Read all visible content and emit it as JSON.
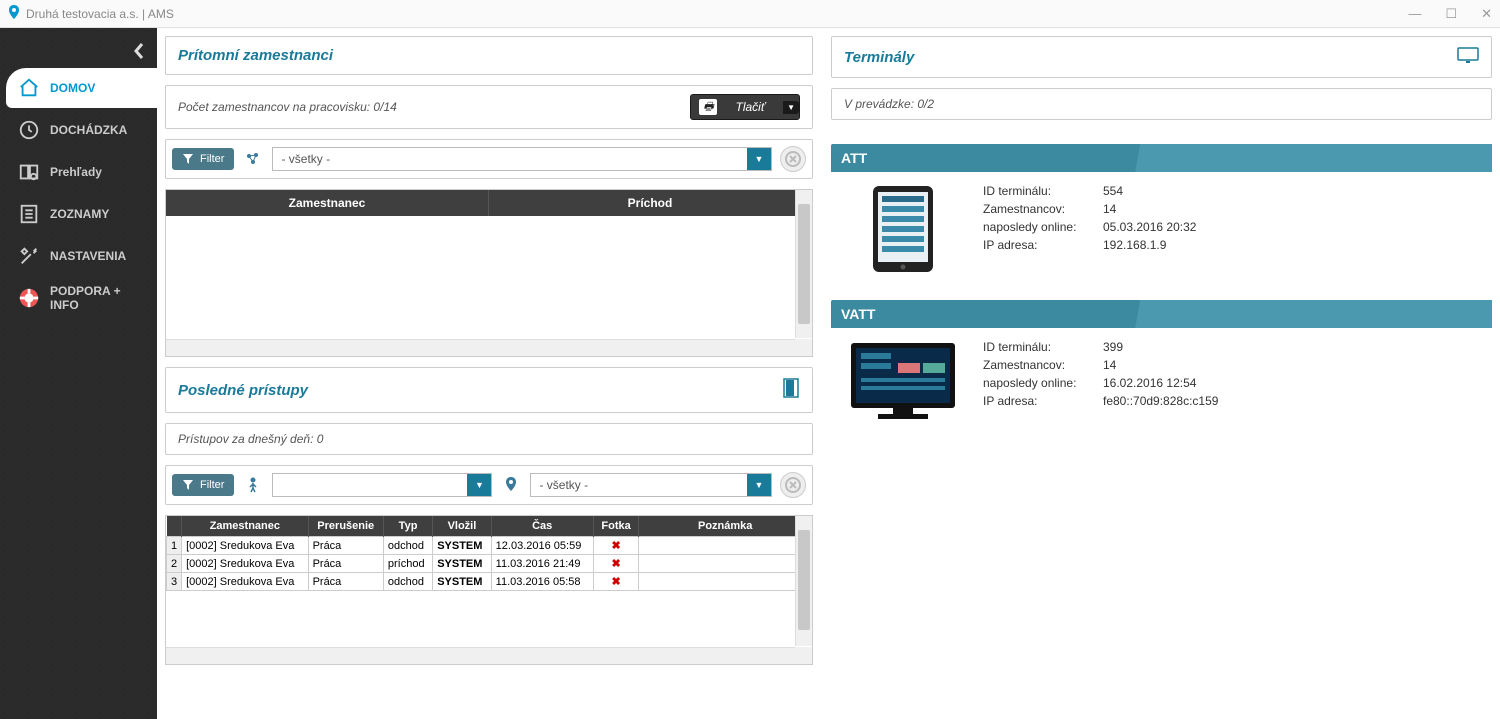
{
  "titlebar": {
    "title": "Druhá testovacia a.s. | AMS"
  },
  "sidebar": {
    "items": [
      {
        "label": "DOMOV"
      },
      {
        "label": "DOCHÁDZKA"
      },
      {
        "label": "Prehľady"
      },
      {
        "label": "ZOZNAMY"
      },
      {
        "label": "NASTAVENIA"
      },
      {
        "label": "PODPORA + INFO"
      }
    ]
  },
  "present": {
    "title": "Prítomní zamestnanci",
    "count_label": "Počet zamestnancov na pracovisku:  0/14",
    "print_label": "Tlačiť",
    "filter_label": "Filter",
    "filter_value": "- všetky -",
    "col_employee": "Zamestnanec",
    "col_arrival": "Príchod"
  },
  "recent": {
    "title": "Posledné prístupy",
    "today_label": "Prístupov za dnešný deň:  0",
    "filter_label": "Filter",
    "filter_employee": "",
    "filter_location": "- všetky -",
    "cols": {
      "employee": "Zamestnanec",
      "interrupt": "Prerušenie",
      "type": "Typ",
      "inserted": "Vložil",
      "time": "Čas",
      "photo": "Fotka",
      "note": "Poznámka"
    },
    "rows": [
      {
        "n": "1",
        "emp": "[0002] Sredukova Eva",
        "int": "Práca",
        "typ": "odchod",
        "vlo": "SYSTEM",
        "cas": "12.03.2016 05:59",
        "foto": "✖",
        "note": ""
      },
      {
        "n": "2",
        "emp": "[0002] Sredukova Eva",
        "int": "Práca",
        "typ": "príchod",
        "vlo": "SYSTEM",
        "cas": "11.03.2016 21:49",
        "foto": "✖",
        "note": ""
      },
      {
        "n": "3",
        "emp": "[0002] Sredukova Eva",
        "int": "Práca",
        "typ": "odchod",
        "vlo": "SYSTEM",
        "cas": "11.03.2016 05:58",
        "foto": "✖",
        "note": ""
      }
    ]
  },
  "terminals": {
    "title": "Terminály",
    "status_label": "V prevádzke:  0/2",
    "labels": {
      "id": "ID terminálu:",
      "emp": "Zamestnancov:",
      "last": "naposledy online:",
      "ip": "IP adresa:"
    },
    "items": [
      {
        "name": "ATT",
        "id": "554",
        "emp": "14",
        "last": "05.03.2016 20:32",
        "ip": "192.168.1.9",
        "kind": "tablet"
      },
      {
        "name": "VATT",
        "id": "399",
        "emp": "14",
        "last": "16.02.2016 12:54",
        "ip": "fe80::70d9:828c:c159",
        "kind": "monitor"
      }
    ]
  }
}
